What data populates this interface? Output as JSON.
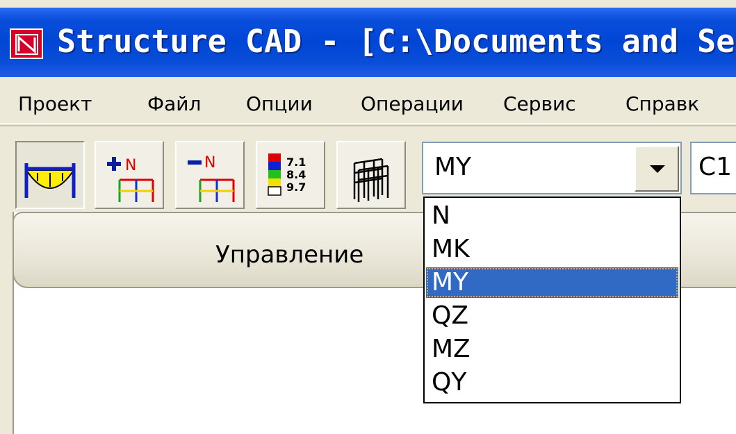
{
  "window": {
    "title": "Structure CAD  - [C:\\Documents and Settin",
    "icon": "app-logo-icon"
  },
  "menu": {
    "items": [
      "Проект",
      "Файл",
      "Опции",
      "Операции",
      "Сервис",
      "Справк"
    ]
  },
  "toolbar": {
    "buttons": [
      {
        "name": "diagram-moment-button",
        "icon": "moment-diagram-icon",
        "pressed": true
      },
      {
        "name": "plus-n-button",
        "icon": "plus-n-frame-icon",
        "label": "N"
      },
      {
        "name": "minus-n-button",
        "icon": "minus-n-frame-icon",
        "label": "N"
      },
      {
        "name": "color-scale-button",
        "icon": "color-scale-icon",
        "values": [
          "7.1",
          "8.4",
          "9.7"
        ]
      },
      {
        "name": "3d-frame-button",
        "icon": "3d-frame-icon"
      }
    ],
    "force_combo": {
      "value": "MY",
      "options": [
        "N",
        "MK",
        "MY",
        "QZ",
        "MZ",
        "QY"
      ],
      "selected_index": 2
    },
    "second_combo": {
      "value": "C1"
    }
  },
  "panel": {
    "tab_label": "Управление"
  },
  "colors": {
    "titlebar": "#0046d5",
    "selection": "#316ac5",
    "chrome": "#ece9d8"
  }
}
